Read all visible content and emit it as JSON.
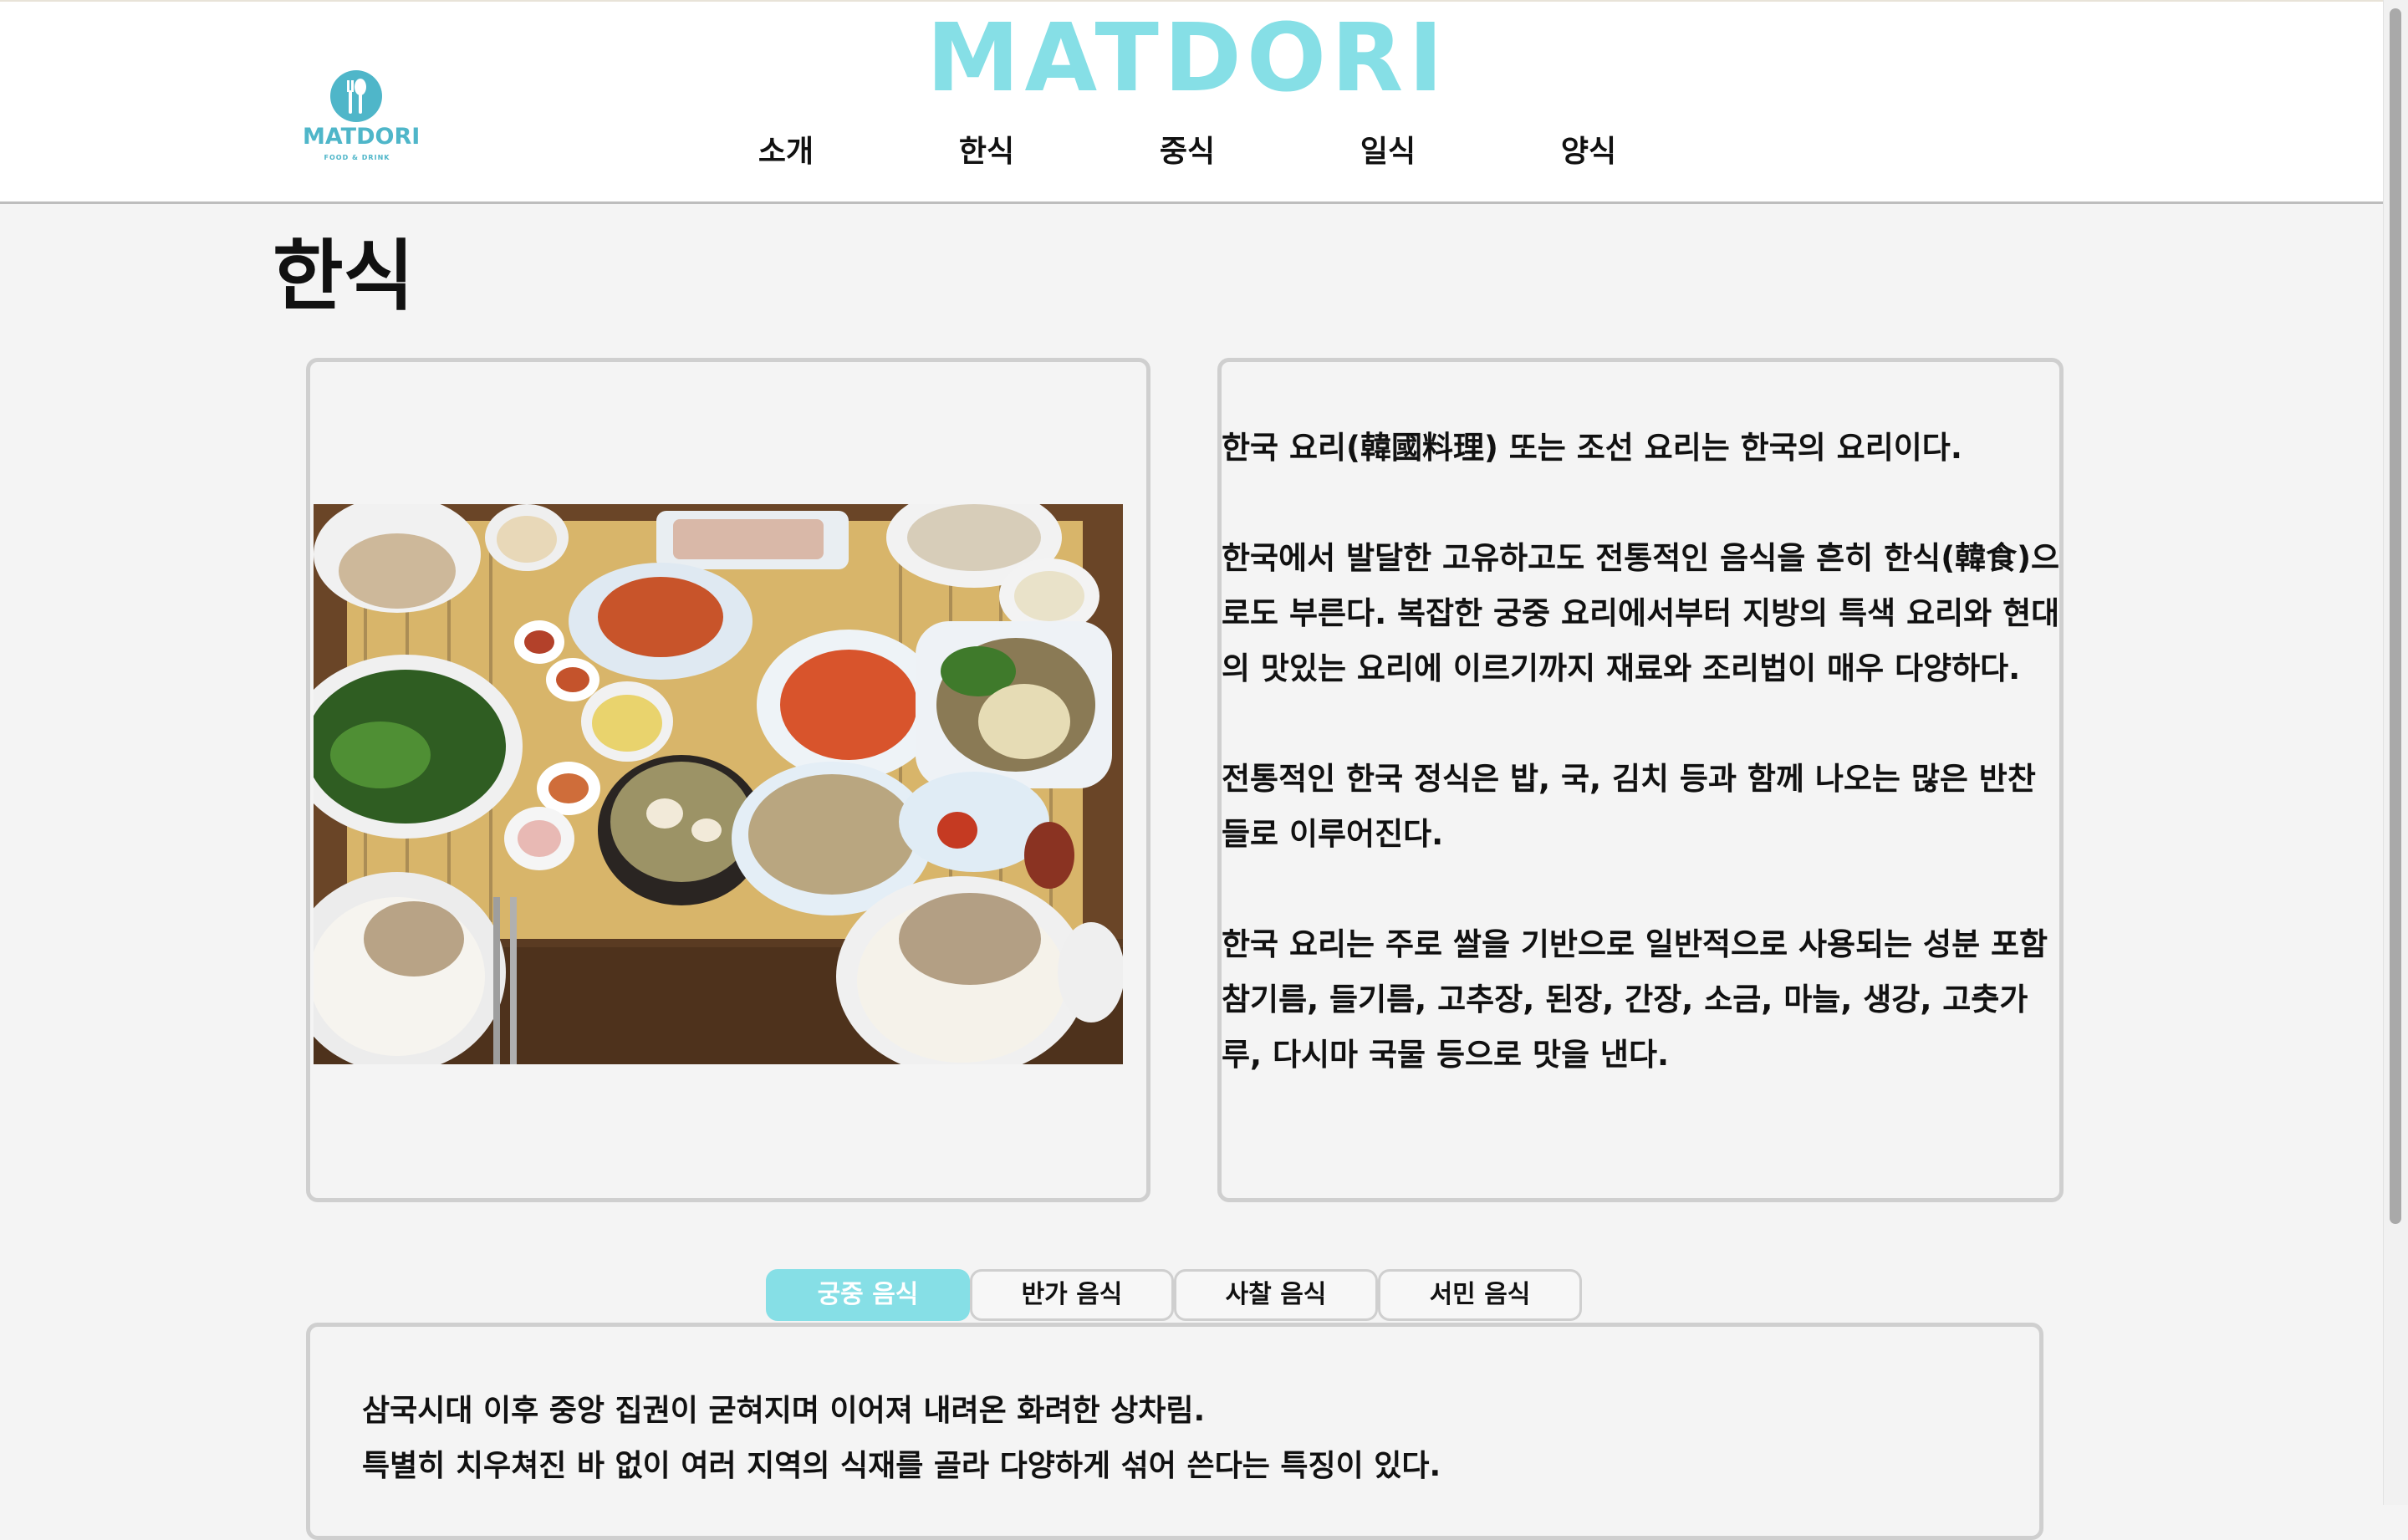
{
  "header": {
    "brand": "MATDORI",
    "logo": {
      "text": "MATDORI",
      "subtext": "FOOD & DRINK",
      "icon": "fork-spoon-icon"
    },
    "nav": [
      {
        "label": "소개"
      },
      {
        "label": "한식"
      },
      {
        "label": "중식"
      },
      {
        "label": "일식"
      },
      {
        "label": "양식"
      }
    ]
  },
  "page": {
    "title": "한식",
    "paragraphs": [
      "한국 요리(韓國料理) 또는 조선 요리는 한국의 요리이다.",
      "한국에서 발달한 고유하고도 전통적인 음식을 흔히 한식(韓食)으로도 부른다. 복잡한 궁중 요리에서부터 지방의 특색 요리와 현대의 맛있는 요리에 이르기까지 재료와 조리법이 매우 다양하다.",
      "전통적인 한국 정식은 밥, 국, 김치 등과 함께 나오는 많은 반찬들로 이루어진다.",
      "한국 요리는 주로 쌀을 기반으로 일반적으로 사용되는 성분 포함 참기름, 들기름, 고추장, 된장, 간장, 소금, 마늘, 생강, 고춧가루, 다시마 국물 등으로 맛을 낸다."
    ],
    "tabs": [
      {
        "label": "궁중 음식",
        "active": true
      },
      {
        "label": "반가 음식",
        "active": false
      },
      {
        "label": "사찰 음식",
        "active": false
      },
      {
        "label": "서민 음식",
        "active": false
      }
    ],
    "tab_description": [
      "삼국시대 이후 중앙 집권이 굳혀지며 이어져 내려온 화려한 상차림.",
      "특별히 치우쳐진 바 없이 여러 지역의 식재를 골라 다양하게 섞어 쓴다는 특징이 있다."
    ]
  },
  "colors": {
    "brand": "#86dfe6",
    "active_tab": "#86dfe6",
    "logo": "#4fb6c9"
  }
}
